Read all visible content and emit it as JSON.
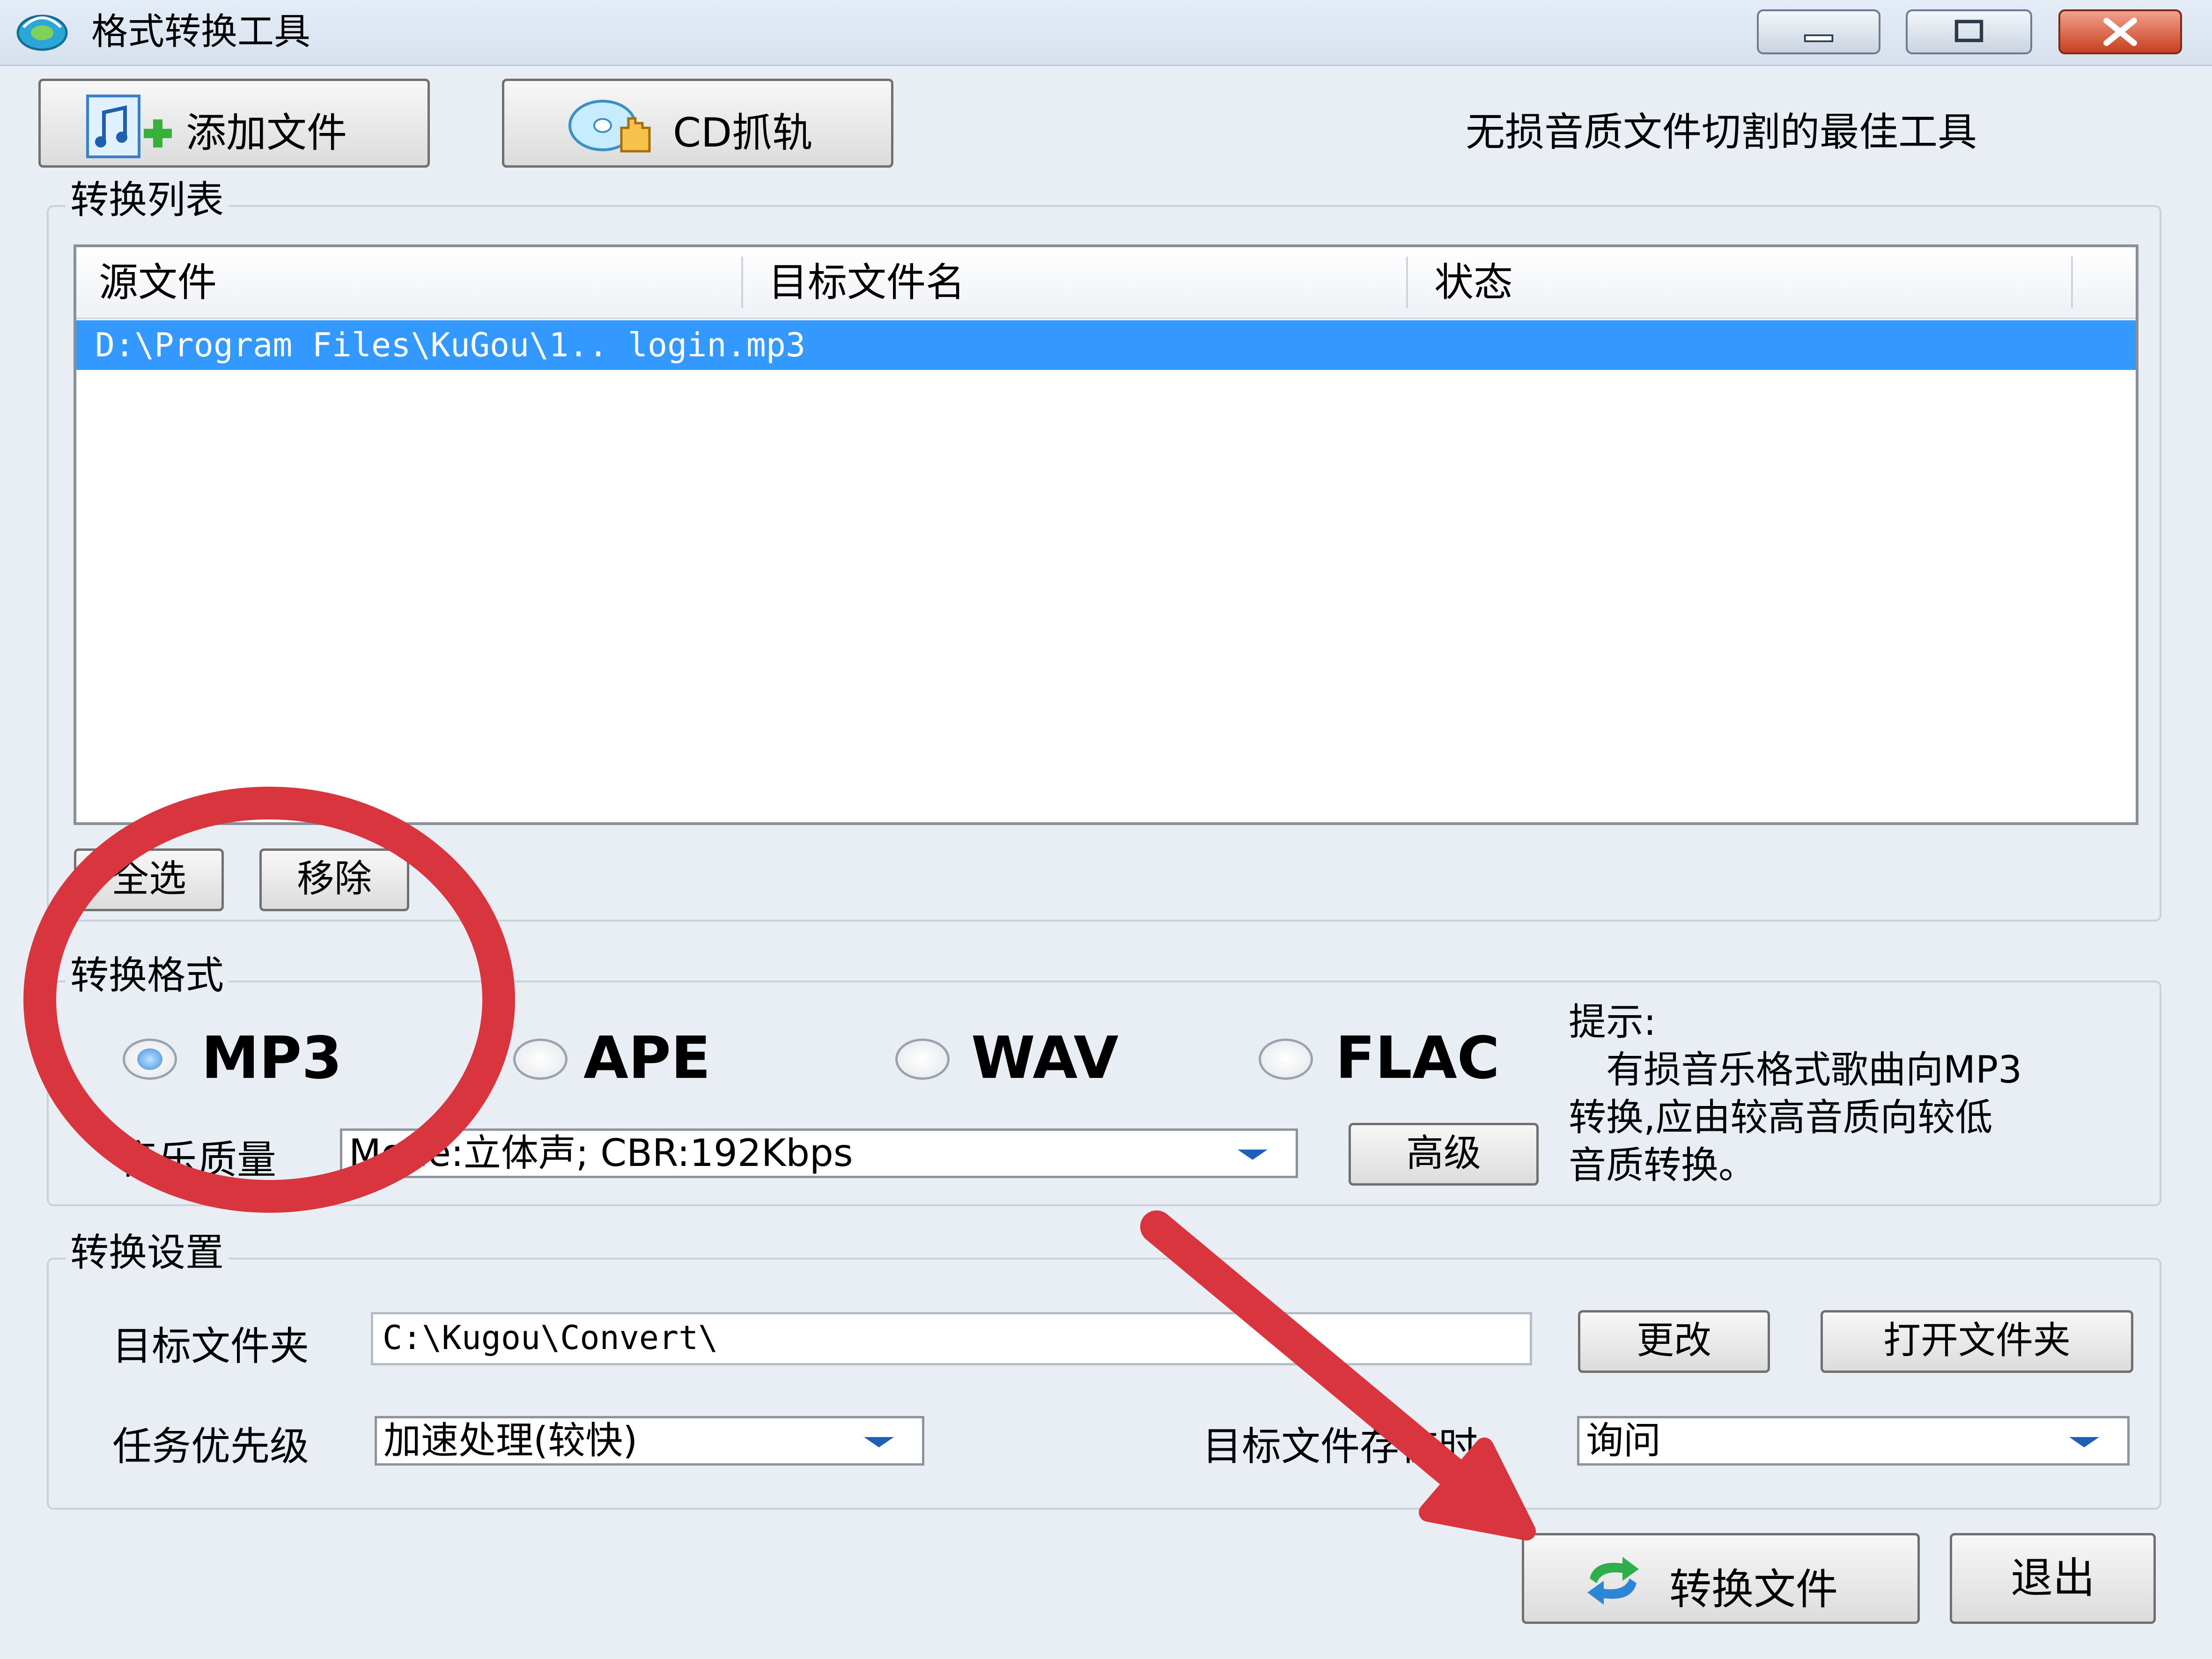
{
  "window": {
    "title": "格式转换工具",
    "controls": {
      "minimize": "minimize-icon",
      "maximize": "maximize-icon",
      "close": "close-icon"
    }
  },
  "toolbar": {
    "add_file": "添加文件",
    "cd_rip": "CD抓轨",
    "slogan": "无损音质文件切割的最佳工具"
  },
  "convert_list": {
    "title": "转换列表",
    "columns": [
      "源文件",
      "目标文件名",
      "状态"
    ],
    "rows": [
      {
        "source": "D:\\Program Files\\KuGou\\1.. login.mp3",
        "target": "",
        "status": ""
      }
    ],
    "select_all": "全选",
    "remove": "移除"
  },
  "format": {
    "title": "转换格式",
    "options": [
      "MP3",
      "APE",
      "WAV",
      "FLAC"
    ],
    "selected": "MP3",
    "quality_label": "音乐质量",
    "quality_value": "Mode:立体声; CBR:192Kbps",
    "advanced": "高级",
    "tip_title": "提示:",
    "tip_line1": "有损音乐格式歌曲向MP3",
    "tip_line2": "转换,应由较高音质向较低",
    "tip_line3": "音质转换。"
  },
  "settings": {
    "title": "转换设置",
    "target_folder_label": "目标文件夹",
    "target_folder_value": "C:\\Kugou\\Convert\\",
    "change": "更改",
    "open_folder": "打开文件夹",
    "priority_label": "任务优先级",
    "priority_value": "加速处理(较快)",
    "exists_label": "目标文件存在时",
    "exists_value": "询问"
  },
  "footer": {
    "convert": "转换文件",
    "exit": "退出"
  },
  "annotation_colors": {
    "circle": "#d8353f",
    "arrow": "#d8353f"
  }
}
